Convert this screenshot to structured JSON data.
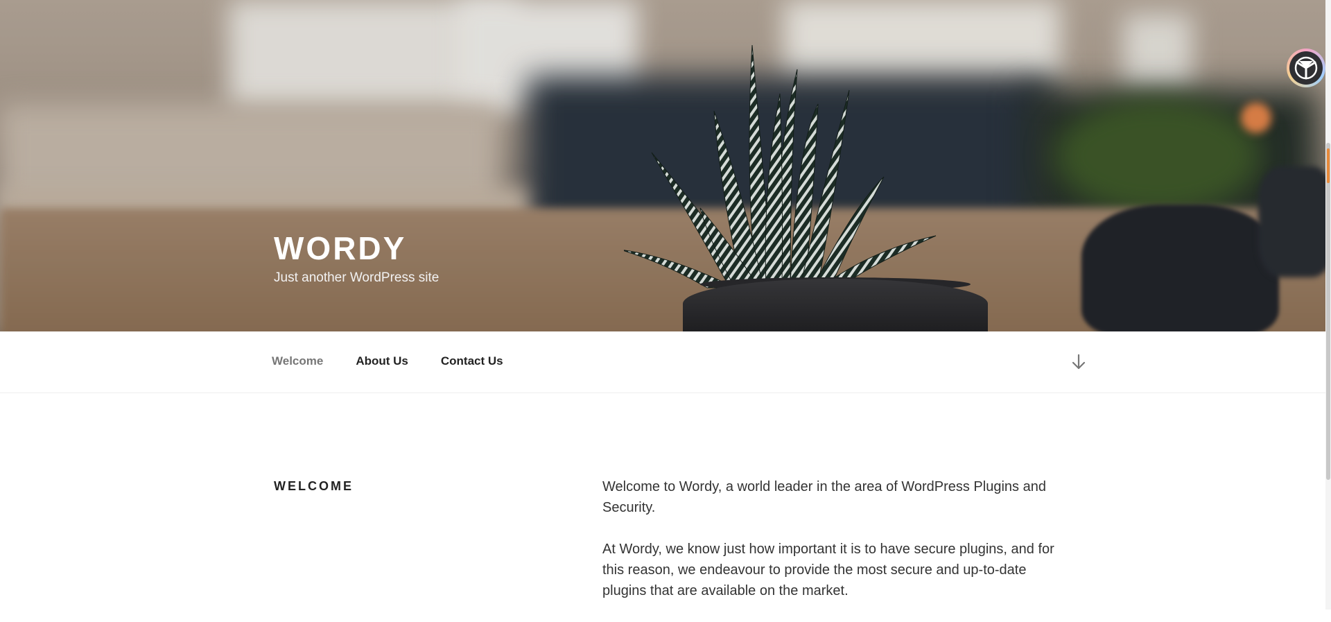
{
  "site": {
    "title": "WORDY",
    "tagline": "Just another WordPress site"
  },
  "nav": {
    "items": [
      {
        "label": "Welcome",
        "current": true
      },
      {
        "label": "About Us",
        "current": false
      },
      {
        "label": "Contact Us",
        "current": false
      }
    ],
    "scroll_icon": "arrow-down-icon"
  },
  "content": {
    "section_title": "WELCOME",
    "paragraphs": [
      "Welcome to Wordy, a world leader in the area of WordPress Plugins and Security.",
      "At Wordy, we know just how important it is to have secure plugins, and for this reason, we endeavour to provide the most secure and up-to-date plugins that are available on the market."
    ]
  },
  "widgets": {
    "avatar_icon": "tripod-logo-icon"
  },
  "colors": {
    "nav_current": "#767676",
    "text": "#222222",
    "scroll_accent": "#e88a3b"
  }
}
